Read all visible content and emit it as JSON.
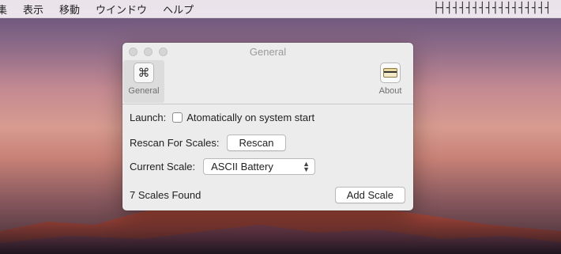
{
  "menubar": {
    "items": [
      "集",
      "表示",
      "移動",
      "ウインドウ",
      "ヘルプ"
    ],
    "scale_status": "├┤┤┤┤┤┤┤┤┤┤┤┤┤┤┤┤┤"
  },
  "window": {
    "title": "General",
    "toolbar": {
      "general": {
        "label": "General",
        "icon": "command-key-icon"
      },
      "about": {
        "label": "About",
        "icon": "card-icon"
      }
    },
    "launch": {
      "label": "Launch:",
      "checkbox_label": "Atomatically on system start",
      "checked": false
    },
    "rescan": {
      "label": "Rescan For Scales:",
      "button_label": "Rescan"
    },
    "current_scale": {
      "label": "Current Scale:",
      "selected": "ASCII Battery"
    },
    "footer": {
      "status": "7 Scales Found",
      "add_button_label": "Add Scale"
    }
  }
}
